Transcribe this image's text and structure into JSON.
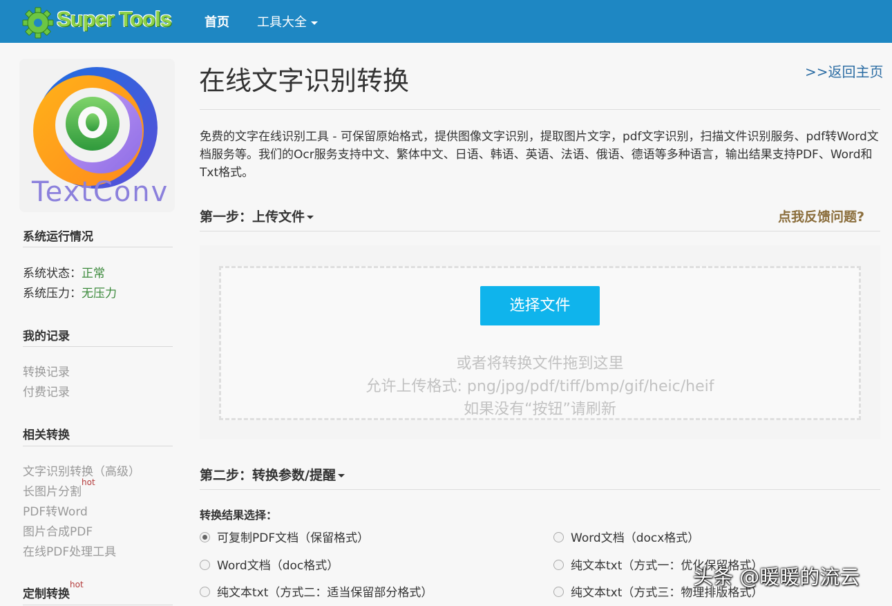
{
  "header": {
    "brand": "Super Tools",
    "nav_home": "首页",
    "nav_tools": "工具大全"
  },
  "logo": {
    "text": "TextConv"
  },
  "sidebar": {
    "status_title": "系统运行情况",
    "status_label": "系统状态：",
    "status_value": "正常",
    "pressure_label": "系统压力：",
    "pressure_value": "无压力",
    "records_title": "我的记录",
    "records": [
      "转换记录",
      "付费记录"
    ],
    "related_title": "相关转换",
    "related": [
      {
        "label": "文字识别转换（高级）",
        "badge": ""
      },
      {
        "label": "长图片分割",
        "badge": "hot"
      },
      {
        "label": "PDF转Word",
        "badge": ""
      },
      {
        "label": "图片合成PDF",
        "badge": ""
      },
      {
        "label": "在线PDF处理工具",
        "badge": ""
      }
    ],
    "custom_title": "定制转换",
    "custom_badge": "hot"
  },
  "main": {
    "title": "在线文字识别转换",
    "back_link": ">>返回主页",
    "intro": "免费的文字在线识别工具 - 可保留原始格式，提供图像文字识别，提取图片文字，pdf文字识别，扫描文件识别服务、pdf转Word文档服务等。我们的Ocr服务支持中文、繁体中文、日语、韩语、英语、法语、俄语、德语等多种语言，输出结果支持PDF、Word和Txt格式。",
    "step1": "第一步：上传文件",
    "feedback": "点我反馈问题?",
    "choose_button": "选择文件",
    "drop_hint": "或者将转换文件拖到这里",
    "formats_hint": "允许上传格式: png/jpg/pdf/tiff/bmp/gif/heic/heif",
    "refresh_hint": "如果没有“按钮”请刷新",
    "step2": "第二步：转换参数/提醒",
    "result_label": "转换结果选择：",
    "options": [
      {
        "label": "可复制PDF文档（保留格式）",
        "checked": true
      },
      {
        "label": "Word文档（docx格式）",
        "checked": false
      },
      {
        "label": "Word文档（doc格式）",
        "checked": false
      },
      {
        "label": "纯文本txt（方式一：优化保留格式）",
        "checked": false
      },
      {
        "label": "纯文本txt（方式二：适当保留部分格式）",
        "checked": false
      },
      {
        "label": "纯文本txt（方式三：物理排版格式）",
        "checked": false
      }
    ]
  },
  "watermark": "头条 @暖暖的流云"
}
